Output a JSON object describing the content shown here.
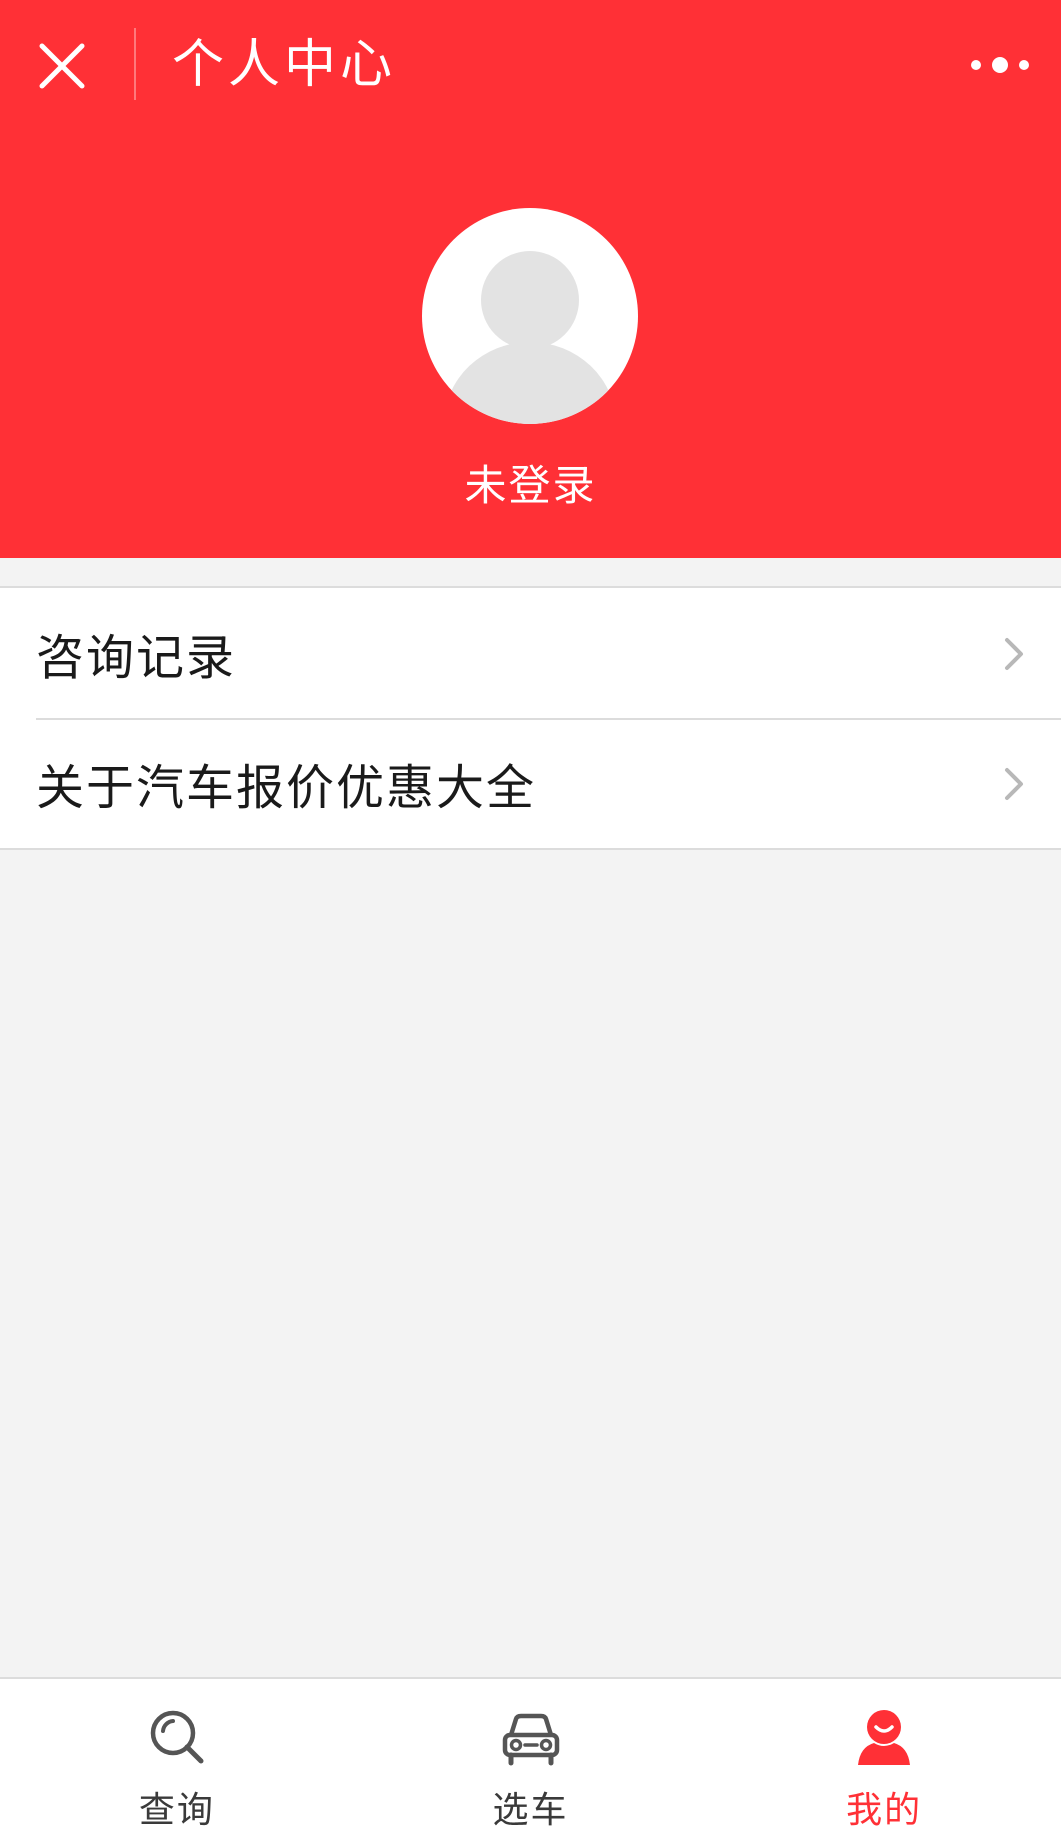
{
  "nav": {
    "title": "个人中心"
  },
  "profile": {
    "login_status": "未登录"
  },
  "menu": {
    "items": [
      {
        "label": "咨询记录"
      },
      {
        "label": "关于汽车报价优惠大全"
      }
    ]
  },
  "tabbar": {
    "tabs": [
      {
        "label": "查询",
        "icon": "search-icon",
        "active": false
      },
      {
        "label": "选车",
        "icon": "car-icon",
        "active": false
      },
      {
        "label": "我的",
        "icon": "user-icon",
        "active": true
      }
    ]
  },
  "colors": {
    "brand_red": "#ff3036",
    "background": "#f3f3f3",
    "divider": "#dcdcdc",
    "tab_inactive": "#3a3a3a"
  }
}
